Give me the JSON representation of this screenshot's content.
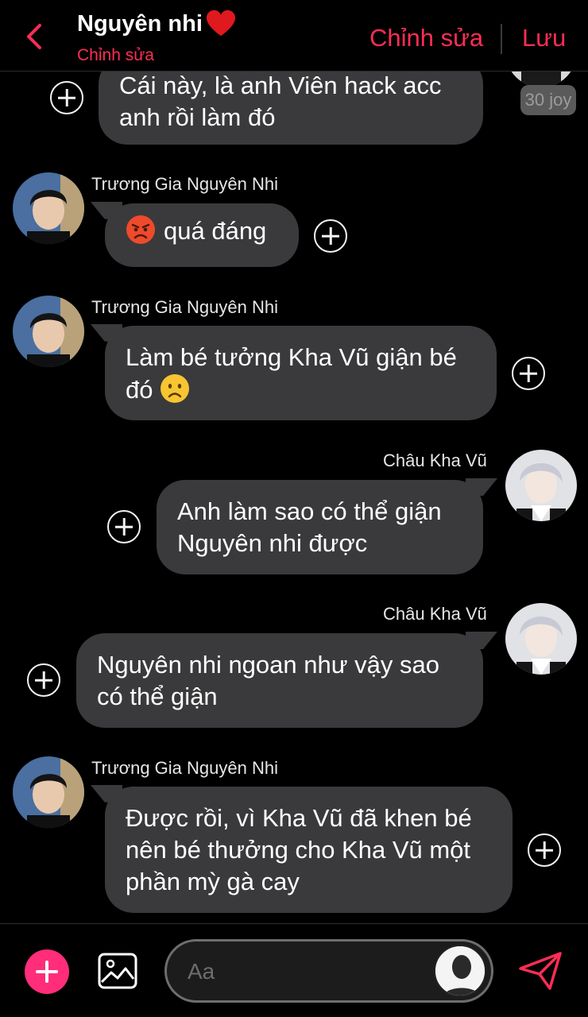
{
  "header": {
    "title": "Nguyên nhi",
    "subtitle": "Chỉnh sửa",
    "edit_label": "Chỉnh sửa",
    "save_label": "Lưu"
  },
  "messages": [
    {
      "text": "Cái này, là anh Viên hack acc anh rồi làm đó",
      "side": "right"
    },
    {
      "sender": "Trương Gia Nguyên Nhi",
      "text": "quá đáng",
      "side": "left",
      "emoji": "angry-face"
    },
    {
      "sender": "Trương Gia Nguyên Nhi",
      "text_line1": "Làm bé tưởng Kha Vũ giận bé",
      "text_line2": "đó",
      "side": "left",
      "emoji": "frowning-face"
    },
    {
      "sender": "Châu Kha Vũ",
      "text": "Anh làm sao có thể giận Nguyên nhi được",
      "side": "right"
    },
    {
      "sender": "Châu Kha Vũ",
      "text": "Nguyên nhi ngoan như vậy sao có thể giận",
      "side": "right"
    },
    {
      "sender": "Trương Gia Nguyên Nhi",
      "text": "Được rồi, vì Kha Vũ đã khen bé nên bé thưởng cho Kha Vũ một phần mỳ gà cay",
      "side": "left"
    }
  ],
  "badge": "30 joy",
  "composer": {
    "placeholder": "Aa"
  },
  "colors": {
    "accent": "#ff2d55",
    "bubble": "#3a3a3c",
    "add_button": "#ff2d7a",
    "background": "#000000"
  }
}
